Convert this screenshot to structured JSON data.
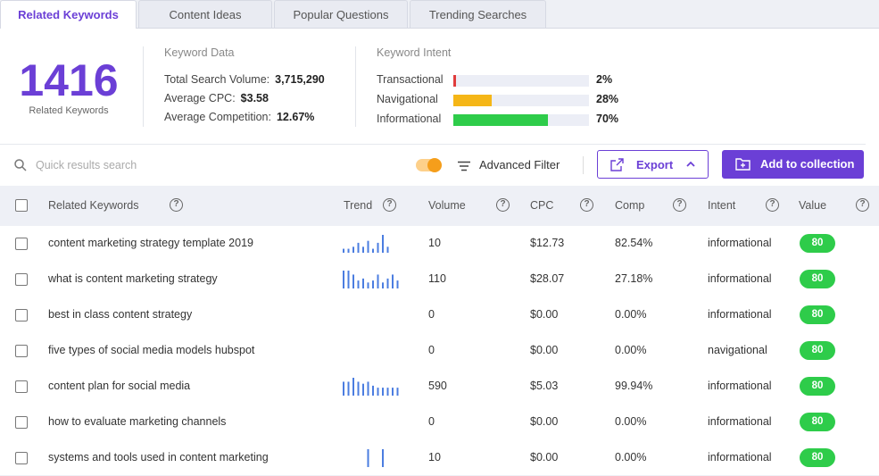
{
  "tabs": [
    {
      "label": "Related Keywords",
      "active": true
    },
    {
      "label": "Content Ideas",
      "active": false
    },
    {
      "label": "Popular Questions",
      "active": false
    },
    {
      "label": "Trending Searches",
      "active": false
    }
  ],
  "summary": {
    "count": "1416",
    "count_label": "Related Keywords",
    "keyword_data": {
      "title": "Keyword Data",
      "rows": [
        {
          "label": "Total Search Volume:",
          "value": "3,715,290"
        },
        {
          "label": "Average CPC:",
          "value": "$3.58"
        },
        {
          "label": "Average Competition:",
          "value": "12.67%"
        }
      ]
    },
    "keyword_intent": {
      "title": "Keyword Intent",
      "rows": [
        {
          "label": "Transactional",
          "pct": "2%",
          "fraction": 0.02,
          "color": "#e03c3c"
        },
        {
          "label": "Navigational",
          "pct": "28%",
          "fraction": 0.28,
          "color": "#f5b617"
        },
        {
          "label": "Informational",
          "pct": "70%",
          "fraction": 0.7,
          "color": "#2ecc4a"
        }
      ]
    }
  },
  "toolbar": {
    "search_placeholder": "Quick results search",
    "filter_label": "Advanced Filter",
    "export_label": "Export",
    "collection_label": "Add to collection"
  },
  "table": {
    "headers": {
      "keyword": "Related Keywords",
      "trend": "Trend",
      "volume": "Volume",
      "cpc": "CPC",
      "comp": "Comp",
      "intent": "Intent",
      "value": "Value"
    },
    "rows": [
      {
        "keyword": "content marketing strategy template 2019",
        "trend": [
          2,
          2,
          3,
          5,
          3,
          6,
          2,
          5,
          9,
          3
        ],
        "volume": "10",
        "cpc": "$12.73",
        "comp": "82.54%",
        "intent": "informational",
        "value": "80"
      },
      {
        "keyword": "what is content marketing strategy",
        "trend": [
          9,
          9,
          7,
          4,
          5,
          3,
          4,
          7,
          3,
          5,
          7,
          4
        ],
        "volume": "110",
        "cpc": "$28.07",
        "comp": "27.18%",
        "intent": "informational",
        "value": "80"
      },
      {
        "keyword": "best in class content strategy",
        "trend": [],
        "volume": "0",
        "cpc": "$0.00",
        "comp": "0.00%",
        "intent": "informational",
        "value": "80"
      },
      {
        "keyword": "five types of social media models hubspot",
        "trend": [],
        "volume": "0",
        "cpc": "$0.00",
        "comp": "0.00%",
        "intent": "navigational",
        "value": "80"
      },
      {
        "keyword": "content plan for social media",
        "trend": [
          7,
          7,
          9,
          7,
          6,
          7,
          5,
          4,
          4,
          4,
          4,
          4
        ],
        "volume": "590",
        "cpc": "$5.03",
        "comp": "99.94%",
        "intent": "informational",
        "value": "80"
      },
      {
        "keyword": "how to evaluate marketing channels",
        "trend": [],
        "volume": "0",
        "cpc": "$0.00",
        "comp": "0.00%",
        "intent": "informational",
        "value": "80"
      },
      {
        "keyword": "systems and tools used in content marketing",
        "trend": [
          0,
          0,
          0,
          0,
          0,
          9,
          0,
          0,
          9
        ],
        "volume": "10",
        "cpc": "$0.00",
        "comp": "0.00%",
        "intent": "informational",
        "value": "80"
      }
    ]
  },
  "colors": {
    "accent": "#6b3fd6",
    "badge": "#2ecc4a",
    "trend": "#4b7de0",
    "toggle": "#f59e1b"
  },
  "icons": [
    "search-icon",
    "filter-icon",
    "export-icon",
    "chevron-up-icon",
    "folder-plus-icon",
    "help-icon"
  ]
}
